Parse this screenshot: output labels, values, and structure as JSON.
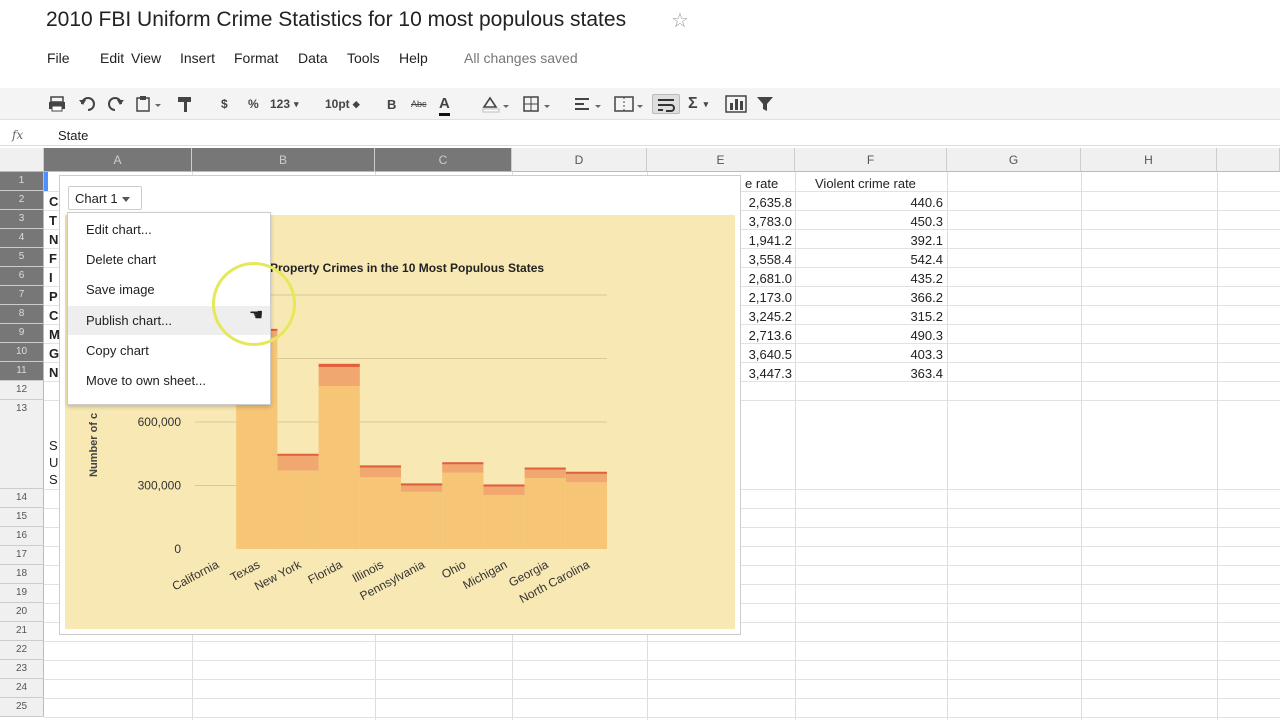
{
  "doc": {
    "title": "2010 FBI Uniform Crime Statistics for 10 most populous states",
    "saved_status": "All changes saved"
  },
  "menu": [
    "File",
    "Edit",
    "View",
    "Insert",
    "Format",
    "Data",
    "Tools",
    "Help"
  ],
  "toolbar": {
    "currency": "$",
    "percent": "%",
    "number_format": "123",
    "font_size": "10pt",
    "bold": "B",
    "strikethrough": "Abc",
    "text_color": "A",
    "sum": "Σ"
  },
  "formula_bar": {
    "fx": "fx",
    "value": "State"
  },
  "columns": [
    "A",
    "B",
    "C",
    "D",
    "E",
    "F",
    "G",
    "H"
  ],
  "rows": [
    "1",
    "2",
    "3",
    "4",
    "5",
    "6",
    "7",
    "8",
    "9",
    "10",
    "11",
    "12",
    "13",
    "14",
    "15",
    "16",
    "17",
    "18",
    "19",
    "20",
    "21",
    "22",
    "23",
    "24",
    "25"
  ],
  "left_fragments": {
    "col_a_letters": [
      "C",
      "T",
      "N",
      "F",
      "I",
      "P",
      "C",
      "M",
      "G",
      "N"
    ],
    "row13_letters": [
      "S",
      "U",
      "S"
    ]
  },
  "table": {
    "header_e": "e rate",
    "header_f": "Violent crime rate",
    "property_rate_partial": [
      "2,635.8",
      "3,783.0",
      "1,941.2",
      "3,558.4",
      "2,681.0",
      "2,173.0",
      "3,245.2",
      "2,713.6",
      "3,640.5",
      "3,447.3"
    ],
    "violent_rate": [
      "440.6",
      "450.3",
      "392.1",
      "542.4",
      "435.2",
      "366.2",
      "315.2",
      "490.3",
      "403.3",
      "363.4"
    ]
  },
  "chart": {
    "button_label": "Chart 1",
    "menu_items": [
      "Edit chart...",
      "Delete chart",
      "Save image",
      "Publish chart...",
      "Copy chart",
      "Move to own sheet..."
    ],
    "hovered_item": "Publish chart..."
  },
  "chart_data": {
    "type": "area",
    "title": "Property Crimes in the 10 Most Populous States",
    "ylabel": "Number of c",
    "ytick_labels": [
      "0",
      "300,000",
      "600,000"
    ],
    "ylim": [
      0,
      1200000
    ],
    "categories": [
      "California",
      "Texas",
      "New York",
      "Florida",
      "Illinois",
      "Pennsylvania",
      "Ohio",
      "Michigan",
      "Georgia",
      "North Carolina"
    ],
    "series": [
      {
        "values": [
          null,
          1000000,
          370000,
          770000,
          340000,
          270000,
          360000,
          255000,
          335000,
          315000
        ]
      },
      {
        "values": [
          null,
          30000,
          70000,
          90000,
          45000,
          30000,
          40000,
          40000,
          40000,
          40000
        ]
      },
      {
        "values": [
          null,
          10000,
          10000,
          15000,
          10000,
          10000,
          10000,
          10000,
          10000,
          10000
        ]
      }
    ],
    "colors": [
      "#f6c676",
      "#f0a870",
      "#e0603a"
    ],
    "grid": true
  }
}
